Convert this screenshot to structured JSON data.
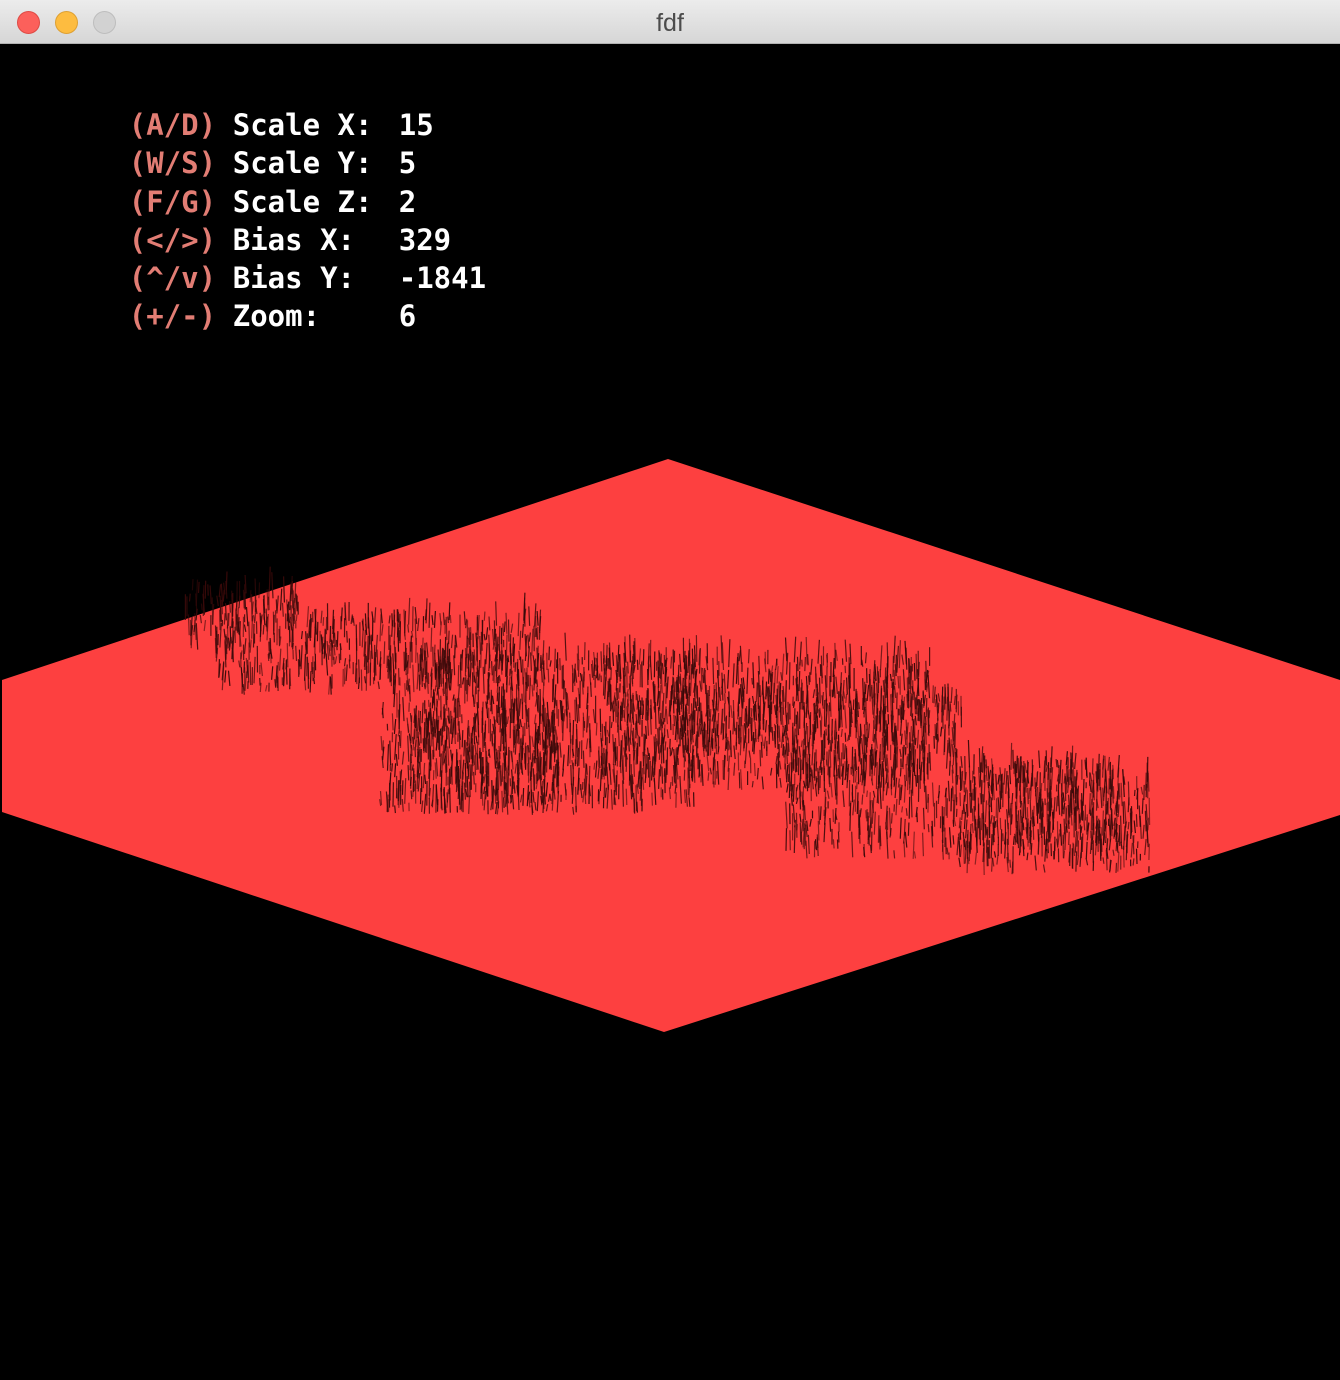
{
  "window": {
    "title": "fdf"
  },
  "hud": {
    "rows": [
      {
        "key": "(A/D)",
        "label": "Scale X:",
        "value": "15"
      },
      {
        "key": "(W/S)",
        "label": "Scale Y:",
        "value": "5"
      },
      {
        "key": "(F/G)",
        "label": "Scale Z:",
        "value": "2"
      },
      {
        "key": "(</>)",
        "label": "Bias X:",
        "value": "329"
      },
      {
        "key": "(^/v)",
        "label": "Bias Y:",
        "value": "-1841"
      },
      {
        "key": "(+/-)",
        "label": "Zoom:",
        "value": "6"
      }
    ]
  },
  "colors": {
    "plane": "#fd4040",
    "terrain": "#3a0a0a",
    "key_text": "#e27d74",
    "label_text": "#ffffff",
    "background": "#000000"
  }
}
